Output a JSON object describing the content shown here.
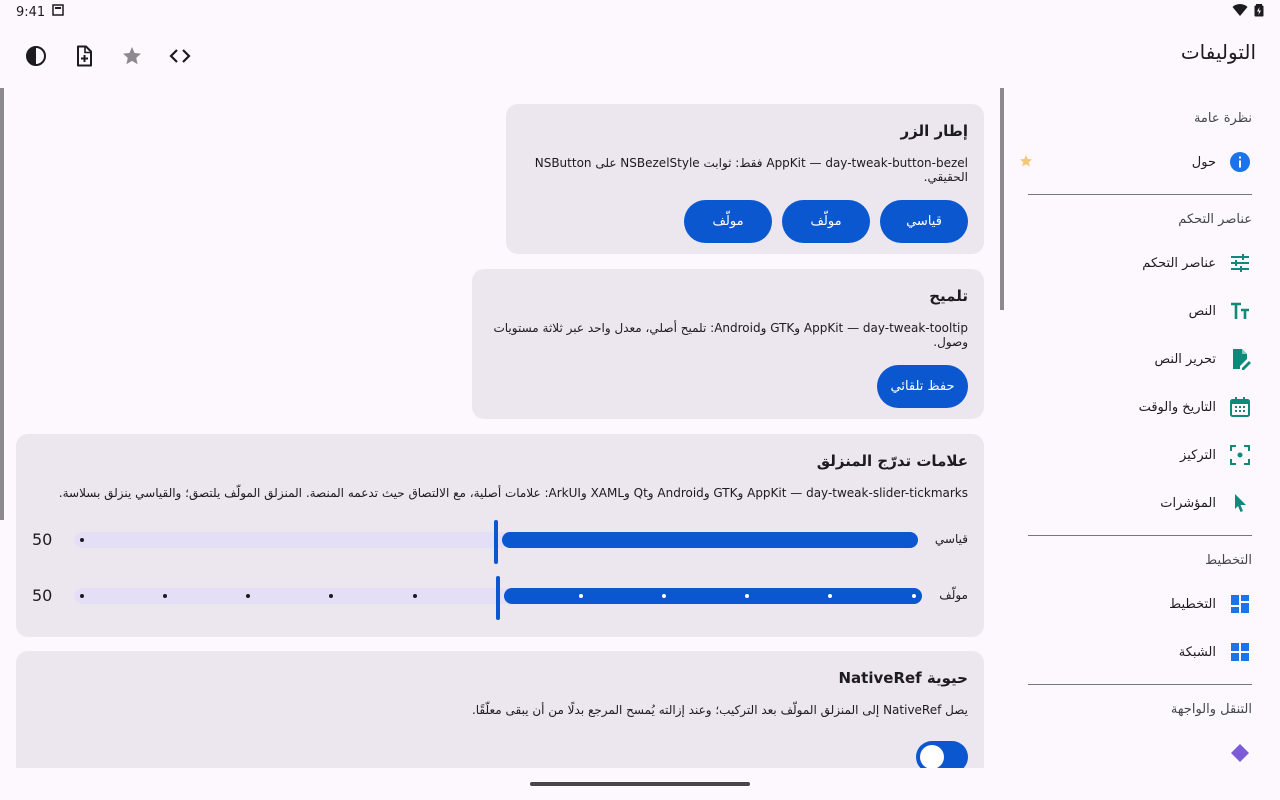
{
  "status_bar": {
    "time": "9:41"
  },
  "app": {
    "title": "التوليفات"
  },
  "toolbar": {
    "icons": [
      "contrast-icon",
      "note-add-icon",
      "star-icon",
      "code-icon"
    ]
  },
  "sidebar": {
    "sections": [
      {
        "title": "نظرة عامة",
        "items": [
          {
            "label": "حول",
            "icon": "info-icon",
            "starred": true
          }
        ]
      },
      {
        "title": "عناصر التحكم",
        "items": [
          {
            "label": "عناصر التحكم",
            "icon": "tune-icon"
          },
          {
            "label": "النص",
            "icon": "text-fields-icon"
          },
          {
            "label": "تحرير النص",
            "icon": "edit-document-icon"
          },
          {
            "label": "التاريخ والوقت",
            "icon": "calendar-icon"
          },
          {
            "label": "التركيز",
            "icon": "focus-icon"
          },
          {
            "label": "المؤشرات",
            "icon": "pointer-icon"
          }
        ]
      },
      {
        "title": "التخطيط",
        "items": [
          {
            "label": "التخطيط",
            "icon": "dashboard-icon"
          },
          {
            "label": "الشبكة",
            "icon": "grid-icon"
          }
        ]
      },
      {
        "title": "التنقل والواجهة",
        "items": []
      }
    ]
  },
  "cards": {
    "bezel": {
      "title": "إطار الزر",
      "desc": "AppKit — day-tweak-button-bezel فقط: ثوابت NSBezelStyle على NSButton الحقيقي.",
      "buttons": [
        "قياسي",
        "مولّف",
        "مولّف"
      ]
    },
    "tooltip": {
      "title": "تلميح",
      "desc": "AppKit — day-tweak-tooltip وGTK وAndroid: تلميح أصلي، معدل واحد عبر ثلاثة مستويات وصول.",
      "button": "حفظ تلقائي"
    },
    "tickmarks": {
      "title": "علامات تدرّج المنزلق",
      "desc": "AppKit — day-tweak-slider-tickmarks وGTK وAndroid وQt وXAML وArkUI: علامات أصلية، مع الالتصاق حيث تدعمه المنصة. المنزلق المولّف يلتصق؛ والقياسي ينزلق بسلاسة.",
      "sliders": [
        {
          "label": "قياسي",
          "value": "50",
          "fraction": 0.5,
          "ticks": false
        },
        {
          "label": "مولّف",
          "value": "50",
          "fraction": 0.5,
          "ticks": true
        }
      ]
    },
    "nativeref": {
      "title": "حيوية NativeRef",
      "desc": "يصل NativeRef إلى المنزلق المولّف بعد التركيب؛ وعند إزالته يُمسح المرجع بدلًا من أن يبقى معلّقًا.",
      "toggle_on": true
    }
  },
  "colors": {
    "accent": "#0b57d0",
    "card_bg": "#ece6ee",
    "page_bg": "#fdf8fd",
    "track_inactive": "#e4dff6"
  }
}
